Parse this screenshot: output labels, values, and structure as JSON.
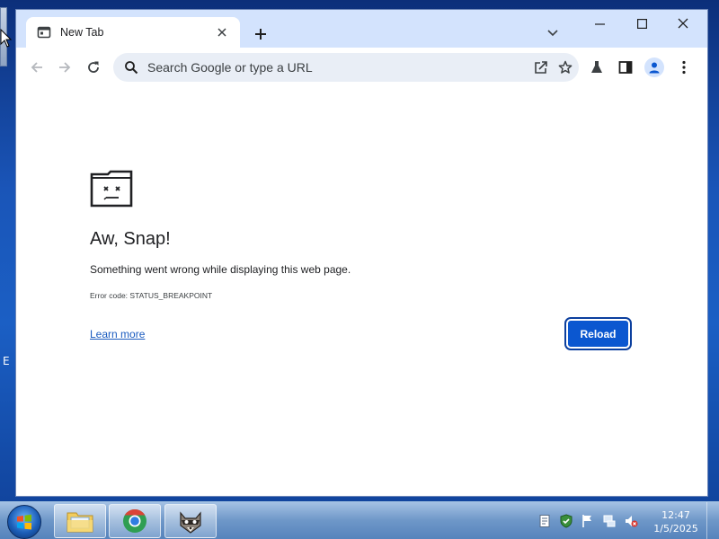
{
  "browser": {
    "tab": {
      "title": "New Tab"
    },
    "omnibox": {
      "placeholder": "Search Google or type a URL"
    }
  },
  "error_page": {
    "heading": "Aw, Snap!",
    "message": "Something went wrong while displaying this web page.",
    "error_code": "Error code: STATUS_BREAKPOINT",
    "learn_more": "Learn more",
    "reload_label": "Reload"
  },
  "desktop": {
    "partial_label": "E"
  },
  "taskbar": {
    "apps": [
      "file-explorer",
      "chrome",
      "raccoon-game"
    ],
    "clock": {
      "time": "12:47",
      "date": "1/5/2025"
    }
  },
  "colors": {
    "accent": "#0b57d0",
    "link": "#1a5bbf",
    "chrome_frame": "#d3e3fd"
  }
}
